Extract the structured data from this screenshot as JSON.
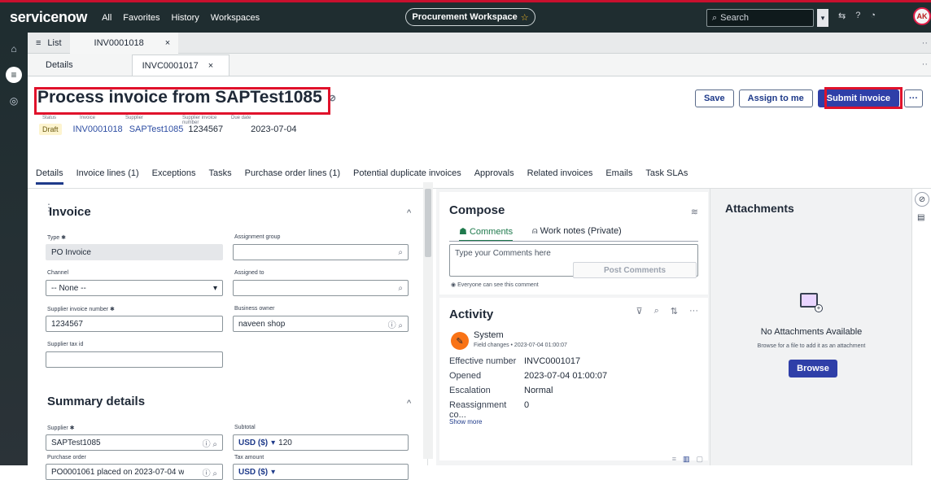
{
  "nav": {
    "logo": "servicenow",
    "links": [
      "All",
      "Favorites",
      "History",
      "Workspaces"
    ],
    "workspace_pill": "Procurement Workspace",
    "search_placeholder": "Search",
    "avatar_initials": "AK"
  },
  "tabs_top": {
    "list_label": "List",
    "record_tab": "INV0001018"
  },
  "tabs_sub": {
    "details_tab": "Details",
    "record_tab": "INVC0001017"
  },
  "header": {
    "title": "Process invoice from SAPTest1085",
    "meta_labels": [
      "Status",
      "Invoice",
      "Supplier",
      "Supplier invoice number",
      "Due date"
    ],
    "status": "Draft",
    "invoice": "INV0001018",
    "supplier": "SAPTest1085",
    "supplier_invoice_number": "1234567",
    "due_date": "2023-07-04",
    "buttons": {
      "save": "Save",
      "assign": "Assign to me",
      "submit": "Submit invoice",
      "more": "···"
    },
    "record_tabs": [
      "Details",
      "Invoice lines (1)",
      "Exceptions",
      "Tasks",
      "Purchase order lines (1)",
      "Potential duplicate invoices",
      "Approvals",
      "Related invoices",
      "Emails",
      "Task SLAs"
    ]
  },
  "invoice_section": {
    "title": "Invoice",
    "type_label": "Type",
    "type_value": "PO Invoice",
    "assignment_group_label": "Assignment group",
    "channel_label": "Channel",
    "channel_value": "-- None --",
    "assigned_to_label": "Assigned to",
    "supplier_invoice_number_label": "Supplier invoice number",
    "supplier_invoice_number_value": "1234567",
    "business_owner_label": "Business owner",
    "business_owner_value": "naveen shop",
    "supplier_tax_id_label": "Supplier tax id"
  },
  "summary_section": {
    "title": "Summary details",
    "supplier_label": "Supplier",
    "supplier_value": "SAPTest1085",
    "subtotal_label": "Subtotal",
    "subtotal_currency": "USD ($)",
    "subtotal_value": "120",
    "purchase_order_label": "Purchase order",
    "purchase_order_value": "PO0001061 placed on 2023-07-04 w",
    "tax_amount_label": "Tax amount",
    "tax_currency": "USD ($)"
  },
  "compose": {
    "title": "Compose",
    "tab_comments": "Comments",
    "tab_worknotes": "Work notes (Private)",
    "placeholder": "Type your Comments here",
    "visibility_note": "Everyone can see this comment",
    "post_button": "Post Comments"
  },
  "activity": {
    "title": "Activity",
    "author": "System",
    "subtitle": "Field changes • 2023-07-04 01:00:07",
    "rows": [
      {
        "k": "Effective number",
        "v": "INVC0001017"
      },
      {
        "k": "Opened",
        "v": "2023-07-04 01:00:07"
      },
      {
        "k": "Escalation",
        "v": "Normal"
      },
      {
        "k": "Reassignment co...",
        "v": "0"
      }
    ],
    "show_more": "Show more"
  },
  "attachments": {
    "title": "Attachments",
    "empty_title": "No Attachments Available",
    "empty_sub": "Browse for a file to add it as an attachment",
    "browse": "Browse"
  },
  "colors": {
    "nav_bg": "#1f2d30",
    "accent": "#2f3fa8",
    "highlight": "#e0122b"
  }
}
